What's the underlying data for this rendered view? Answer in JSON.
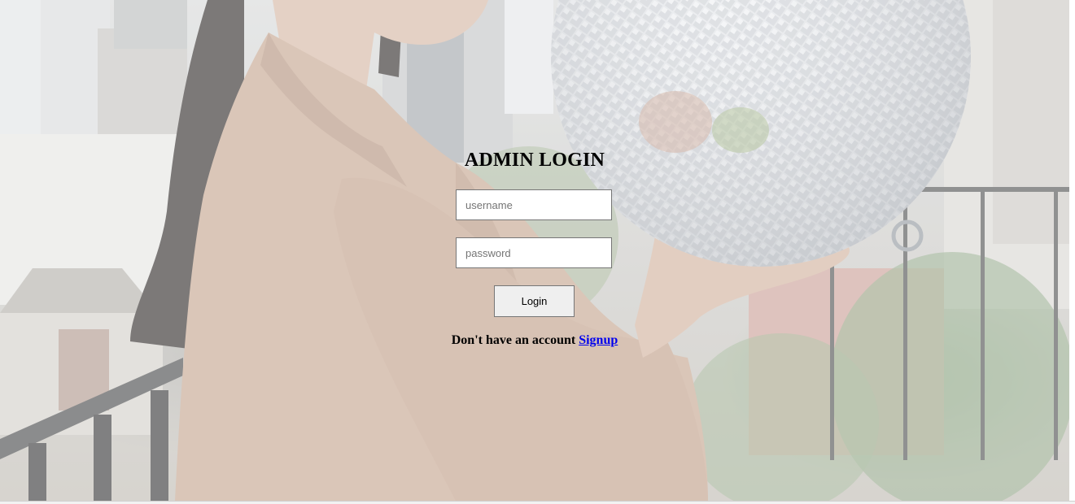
{
  "login": {
    "title": "ADMIN LOGIN",
    "username_placeholder": "username",
    "password_placeholder": "password",
    "login_button": "Login",
    "signup_prompt": "Don't have an account",
    "signup_link": "Signup"
  },
  "colors": {
    "link": "#0000ee",
    "button_bg": "#efefef",
    "jacket": "#c9ab97"
  }
}
